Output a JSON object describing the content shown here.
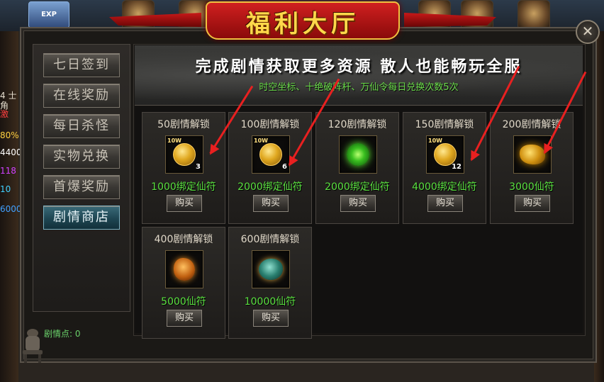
{
  "window": {
    "title": "福利大厅",
    "close_label": "✕"
  },
  "background": {
    "exp_label": "EXP",
    "left_values": [
      "4 士角",
      "激",
      "80%",
      "4400",
      "118",
      "10",
      "6000"
    ]
  },
  "sidebar": {
    "items": [
      {
        "label": "七日签到",
        "active": false
      },
      {
        "label": "在线奖励",
        "active": false
      },
      {
        "label": "每日杀怪",
        "active": false
      },
      {
        "label": "实物兑换",
        "active": false
      },
      {
        "label": "首爆奖励",
        "active": false
      },
      {
        "label": "剧情商店",
        "active": true
      }
    ],
    "plot_points": "剧情点: 0"
  },
  "banner": {
    "headline": "完成剧情获取更多资源 散人也能畅玩全服",
    "subtitle": "时空坐标、十绝破阵杆、万仙令每日兑换次数5次"
  },
  "shop": {
    "buy_label": "购买",
    "items": [
      {
        "title": "50剧情解锁",
        "icon": "gold-coin-icon",
        "coin_label": "10W",
        "count": "3",
        "price": "1000绑定仙符"
      },
      {
        "title": "100剧情解锁",
        "icon": "gold-coin-icon",
        "coin_label": "10W",
        "count": "6",
        "price": "2000绑定仙符"
      },
      {
        "title": "120剧情解锁",
        "icon": "green-orb-icon",
        "coin_label": "",
        "count": "",
        "price": "2000绑定仙符"
      },
      {
        "title": "150剧情解锁",
        "icon": "gold-coin-icon",
        "coin_label": "10W",
        "count": "12",
        "price": "4000绑定仙符"
      },
      {
        "title": "200剧情解锁",
        "icon": "gold-ingot-icon",
        "coin_label": "",
        "count": "",
        "price": "3000仙符"
      },
      {
        "title": "400剧情解锁",
        "icon": "orange-ore-icon",
        "coin_label": "",
        "count": "",
        "price": "5000仙符"
      },
      {
        "title": "600剧情解锁",
        "icon": "teal-stone-icon",
        "coin_label": "",
        "count": "",
        "price": "10000仙符"
      }
    ]
  },
  "colors": {
    "price_green": "#5ae040",
    "title_gold": "#ffd84a",
    "arrow_red": "#e82020"
  }
}
